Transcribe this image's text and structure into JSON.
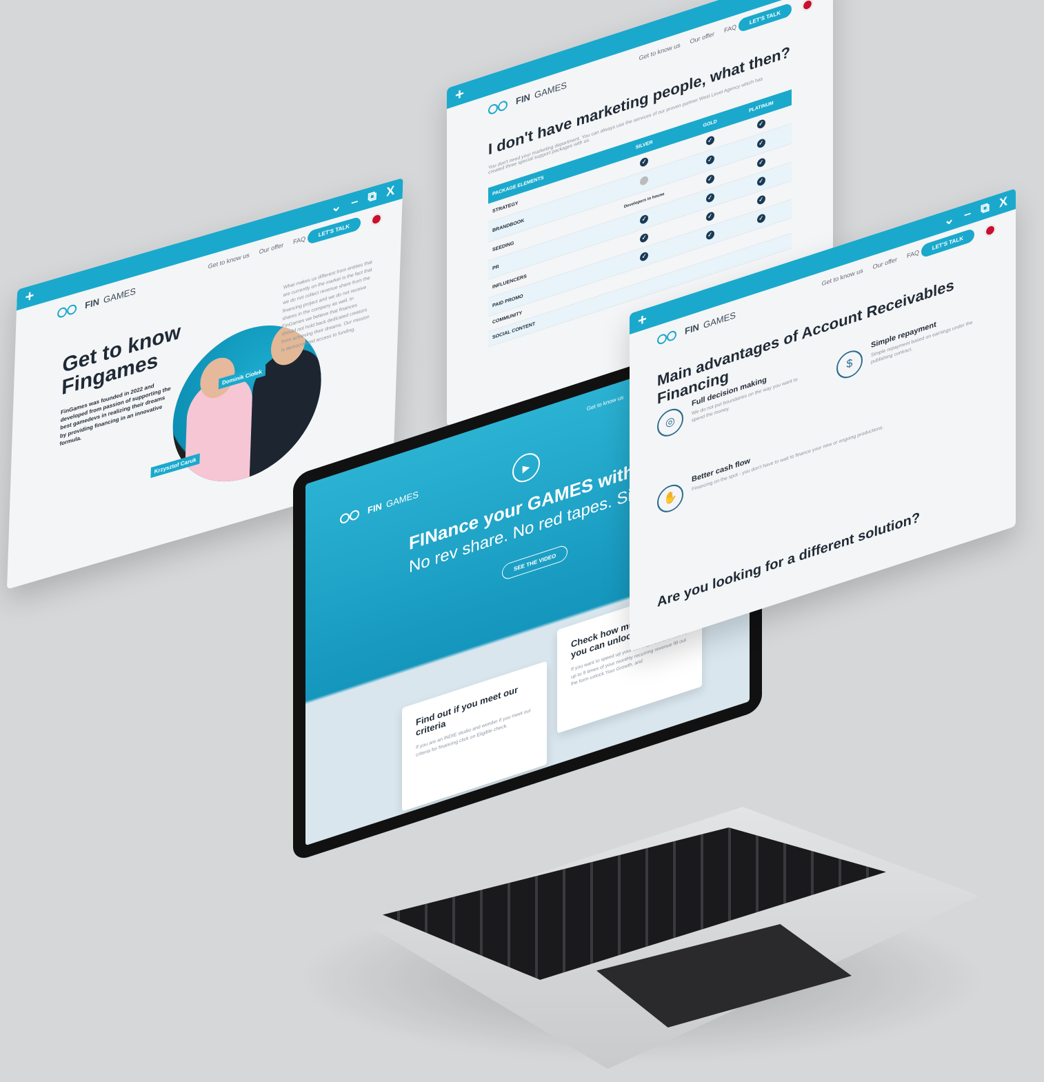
{
  "brand": {
    "logo_bold": "FIN",
    "logo_thin": "GAMES"
  },
  "nav": {
    "links": [
      "Get to know us",
      "Our offer",
      "FAQ"
    ],
    "cta": "LET'S TALK",
    "flag": "uk-flag"
  },
  "window_controls": {
    "plus": "+",
    "chevron": "⌄",
    "minimize": "–",
    "restore": "⧉",
    "close": "X"
  },
  "about": {
    "title": "Get to know Fingames",
    "lead": "FinGames was founded in 2022 and developed from passion of supporting the best gamedevs in realizing their dreams by providing financing in an innovative formula.",
    "tag_ceo": "Krzysztof Caruk",
    "tag_partner": "Dominik Ciołek",
    "column_text": "What makes us different from entities that are currently on the market is the fact that we do not collect revenue share from the financing project and we do not receive shares in the company as well. In FinGames we believe that finances should not hold back dedicated creators from achieving their dreams. Our mission is democratized access to funding."
  },
  "marketing": {
    "title": "I don't have marketing people, what then?",
    "subtitle": "You don't need your marketing department. You can always use the services of our proven partner West Level Agency which has created three special support packages with us.",
    "columns": [
      "PACKAGE ELEMENTS",
      "SILVER",
      "GOLD",
      "PLATINUM"
    ],
    "rows": [
      {
        "label": "STRATEGY",
        "silver": "check",
        "gold": "check",
        "platinum": "check"
      },
      {
        "label": "BRANDBOOK",
        "silver": "dash",
        "gold": "check",
        "platinum": "check"
      },
      {
        "label": "SEEDING",
        "silver": "Developers in house",
        "gold": "check",
        "platinum": "check"
      },
      {
        "label": "PR",
        "silver": "check",
        "gold": "check",
        "platinum": "check"
      },
      {
        "label": "INFLUENCERS",
        "silver": "check",
        "gold": "check",
        "platinum": "check"
      },
      {
        "label": "PAID PROMO",
        "silver": "check",
        "gold": "check",
        "platinum": "check"
      },
      {
        "label": "COMMUNITY",
        "silver": "",
        "gold": "",
        "platinum": ""
      },
      {
        "label": "SOCIAL CONTENT",
        "silver": "",
        "gold": "",
        "platinum": ""
      }
    ]
  },
  "advantages": {
    "title": "Main advantages of Account Receivables Financing",
    "items": [
      {
        "icon": "target-icon",
        "title": "Full decision making",
        "desc": "We do not put boundaries on the way you want to spend the money."
      },
      {
        "icon": "document-dollar-icon",
        "title": "Simple repayment",
        "desc": "Simple repayment based on earnings under the publishing contract."
      },
      {
        "icon": "hand-coin-icon",
        "title": "Better cash flow",
        "desc": "Financing on the spot - you don't have to wait to finance your new or ongoing productions."
      }
    ],
    "footer_question": "Are you looking for a different solution?"
  },
  "hero": {
    "headline": "FINance your GAMES with us",
    "subline": "No rev share. No red tapes. Simply fair.",
    "video_button": "SEE THE VIDEO",
    "cards": [
      {
        "title": "Find out if you meet our criteria",
        "desc": "If you are an INDIE studio and wonder if you meet our criteria for financing click on Eligible check."
      },
      {
        "title": "Check how much capital you can unlock",
        "desc": "If you want to speed up your development and receive up to 9 times of your monthly recurring revenue fill out the form unlock Your Growth, and"
      }
    ]
  },
  "colors": {
    "accent": "#1aa9cc",
    "dark": "#1f2a36",
    "muted": "#8a94a0",
    "background": "#d6d7d9"
  }
}
